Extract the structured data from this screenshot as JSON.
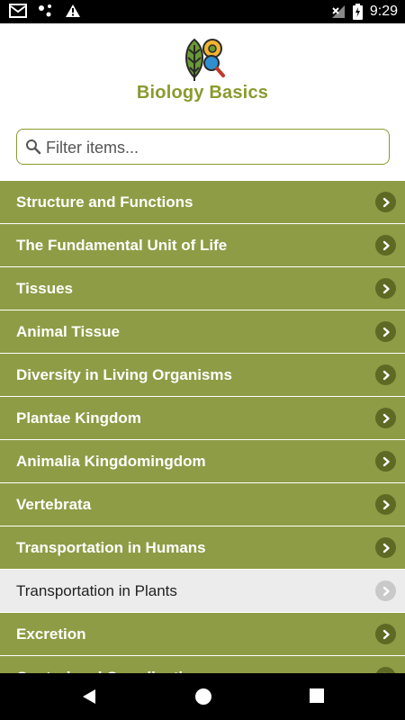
{
  "status_bar": {
    "time": "9:29",
    "icons": [
      "gmail-icon",
      "dots-icon",
      "warning-icon",
      "no-signal-icon",
      "battery-icon"
    ]
  },
  "app": {
    "title": "Biology Basics",
    "logo": "leaf-microscope-icon"
  },
  "search": {
    "placeholder": "Filter items...",
    "value": ""
  },
  "list": {
    "items": [
      {
        "label": "Structure and Functions"
      },
      {
        "label": "The Fundamental Unit of Life"
      },
      {
        "label": "Tissues"
      },
      {
        "label": "Animal Tissue"
      },
      {
        "label": "Diversity in Living Organisms"
      },
      {
        "label": "Plantae Kingdom"
      },
      {
        "label": "Animalia Kingdomingdom"
      },
      {
        "label": "Vertebrata"
      },
      {
        "label": "Transportation in Humans"
      },
      {
        "label": "Transportation in Plants",
        "selected": true
      },
      {
        "label": "Excretion"
      },
      {
        "label": "Control and Coordination"
      }
    ]
  },
  "colors": {
    "accent": "#8a9a2e",
    "item_bg": "#8e9c45",
    "chevron_bg": "#5e6a24",
    "selected_bg": "#ececec"
  },
  "nav": {
    "buttons": [
      "back-icon",
      "home-icon",
      "recents-icon"
    ]
  }
}
